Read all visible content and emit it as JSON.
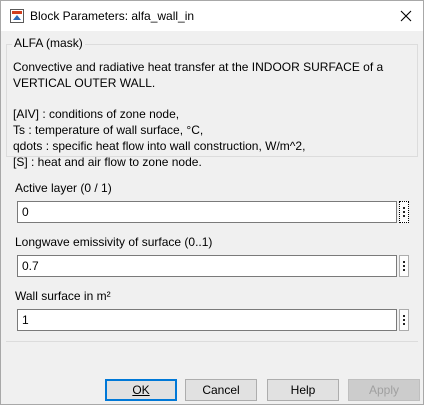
{
  "window": {
    "title": "Block Parameters: alfa_wall_in",
    "icon": "simulink-block-icon"
  },
  "mask": {
    "group_title": "ALFA (mask)",
    "description_1": "Convective and radiative heat transfer at the INDOOR SURFACE of a",
    "description_2": "VERTICAL OUTER WALL.",
    "lines": [
      "[AIV] : conditions of zone node,",
      "Ts : temperature of wall surface, °C,",
      "qdots : specific heat flow into wall construction, W/m^2,",
      "[S] : heat and air flow to zone node."
    ]
  },
  "params": [
    {
      "label": "Active layer (0 / 1)",
      "value": "0"
    },
    {
      "label": "Longwave emissivity of surface (0..1)",
      "value": "0.7"
    },
    {
      "label": "Wall surface in m²",
      "value": "1"
    }
  ],
  "buttons": {
    "ok": "OK",
    "cancel": "Cancel",
    "help": "Help",
    "apply": "Apply"
  }
}
